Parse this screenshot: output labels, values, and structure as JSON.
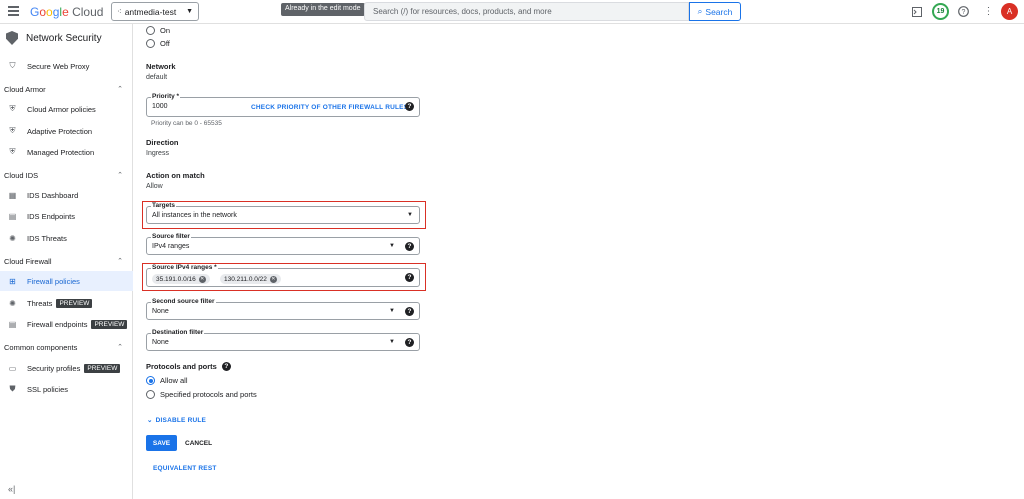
{
  "header": {
    "app_name": "Google Cloud",
    "project": "antmedia-test",
    "tooltip": "Already in the edit mode",
    "search_placeholder": "Search (/) for resources, docs, products, and more",
    "search_button": "Search",
    "notification_count": "19"
  },
  "sidebar": {
    "title": "Network Security",
    "items": [
      {
        "label": "Secure Web Proxy"
      },
      {
        "section": "Cloud Armor"
      },
      {
        "label": "Cloud Armor policies"
      },
      {
        "label": "Adaptive Protection"
      },
      {
        "label": "Managed Protection"
      },
      {
        "section": "Cloud IDS"
      },
      {
        "label": "IDS Dashboard"
      },
      {
        "label": "IDS Endpoints"
      },
      {
        "label": "IDS Threats"
      },
      {
        "section": "Cloud Firewall"
      },
      {
        "label": "Firewall policies",
        "active": true
      },
      {
        "label": "Threats",
        "badge": "PREVIEW"
      },
      {
        "label": "Firewall endpoints",
        "badge": "PREVIEW"
      },
      {
        "section": "Common components"
      },
      {
        "label": "Security profiles",
        "badge": "PREVIEW"
      },
      {
        "label": "SSL policies"
      }
    ]
  },
  "form": {
    "logs_on": "On",
    "logs_off": "Off",
    "network_label": "Network",
    "network_value": "default",
    "priority_label": "Priority *",
    "priority_value": "1000",
    "priority_link": "CHECK PRIORITY OF OTHER FIREWALL RULES",
    "priority_hint": "Priority can be 0 - 65535",
    "direction_label": "Direction",
    "direction_value": "Ingress",
    "action_label": "Action on match",
    "action_value": "Allow",
    "targets_label": "Targets",
    "targets_value": "All instances in the network",
    "source_filter_label": "Source filter",
    "source_filter_value": "IPv4 ranges",
    "source_ranges_label": "Source IPv4 ranges *",
    "source_ranges": [
      "35.191.0.0/16",
      "130.211.0.0/22"
    ],
    "second_source_label": "Second source filter",
    "second_source_value": "None",
    "dest_filter_label": "Destination filter",
    "dest_filter_value": "None",
    "protocols_label": "Protocols and ports",
    "allow_all": "Allow all",
    "specified": "Specified protocols and ports",
    "disable_rule": "DISABLE RULE",
    "save": "SAVE",
    "cancel": "CANCEL",
    "equivalent_rest": "EQUIVALENT REST"
  },
  "colors": {
    "accent": "#1a73e8",
    "highlight": "#d93025",
    "active_bg": "#e8f0fe"
  }
}
